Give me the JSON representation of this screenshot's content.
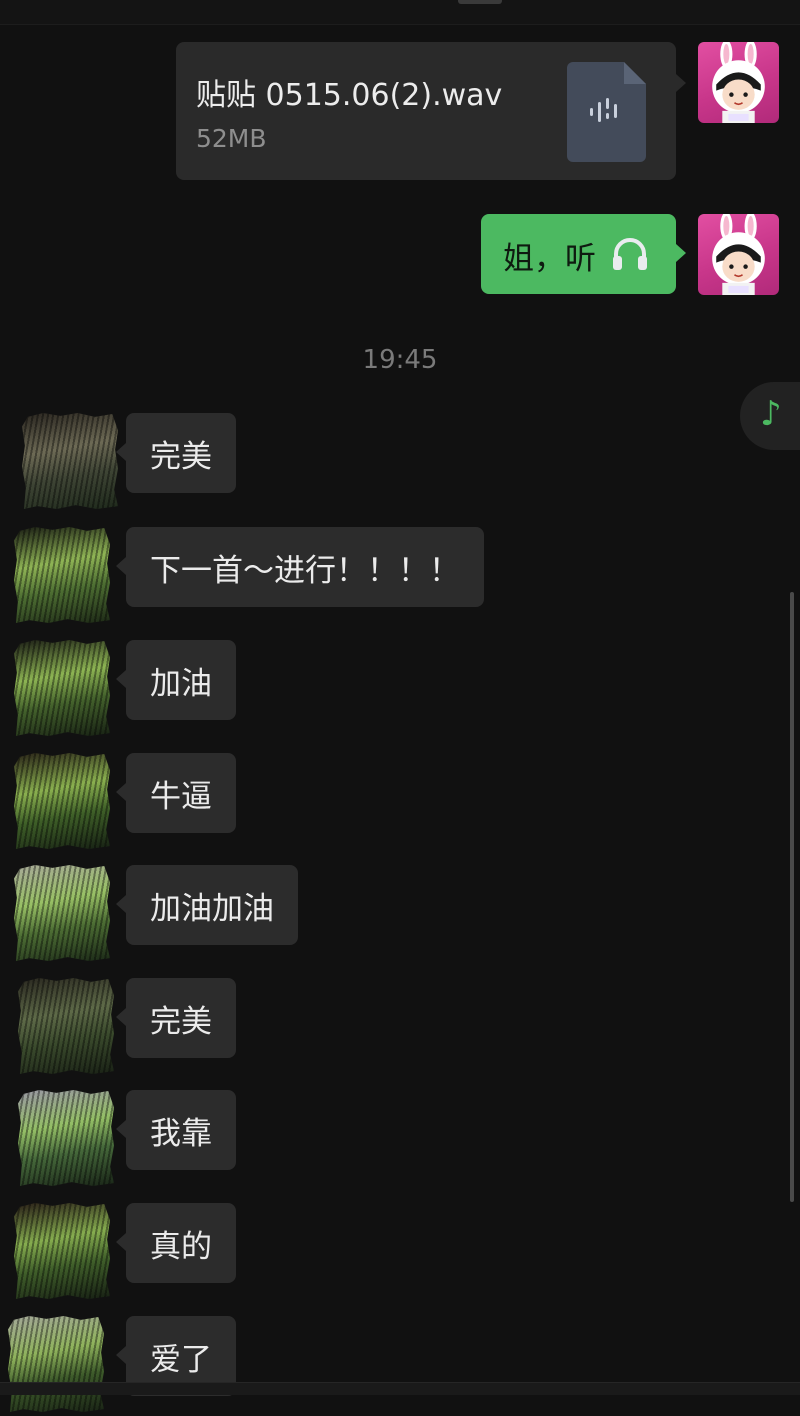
{
  "chat": {
    "file_message": {
      "name": "贴贴 0515.06(2).wav",
      "size": "52MB",
      "icon": "audio-file-icon"
    },
    "self_text": {
      "text": "姐，听",
      "emoji": "headphones-icon"
    },
    "timestamp": "19:45",
    "music_button": {
      "icon": "music-note-icon",
      "glyph": "♪"
    },
    "incoming": [
      {
        "text": "完美"
      },
      {
        "text": "下一首～进行！！！！"
      },
      {
        "text": "加油"
      },
      {
        "text": "牛逼"
      },
      {
        "text": "加油加油"
      },
      {
        "text": "完美"
      },
      {
        "text": "我靠"
      },
      {
        "text": "真的"
      },
      {
        "text": "爱了"
      }
    ]
  },
  "colors": {
    "background": "#111111",
    "self_bubble": "#4cb961",
    "other_bubble": "#2c2c2c",
    "file_bubble": "#2a2a2a",
    "avatar_self": "#c8368a"
  }
}
